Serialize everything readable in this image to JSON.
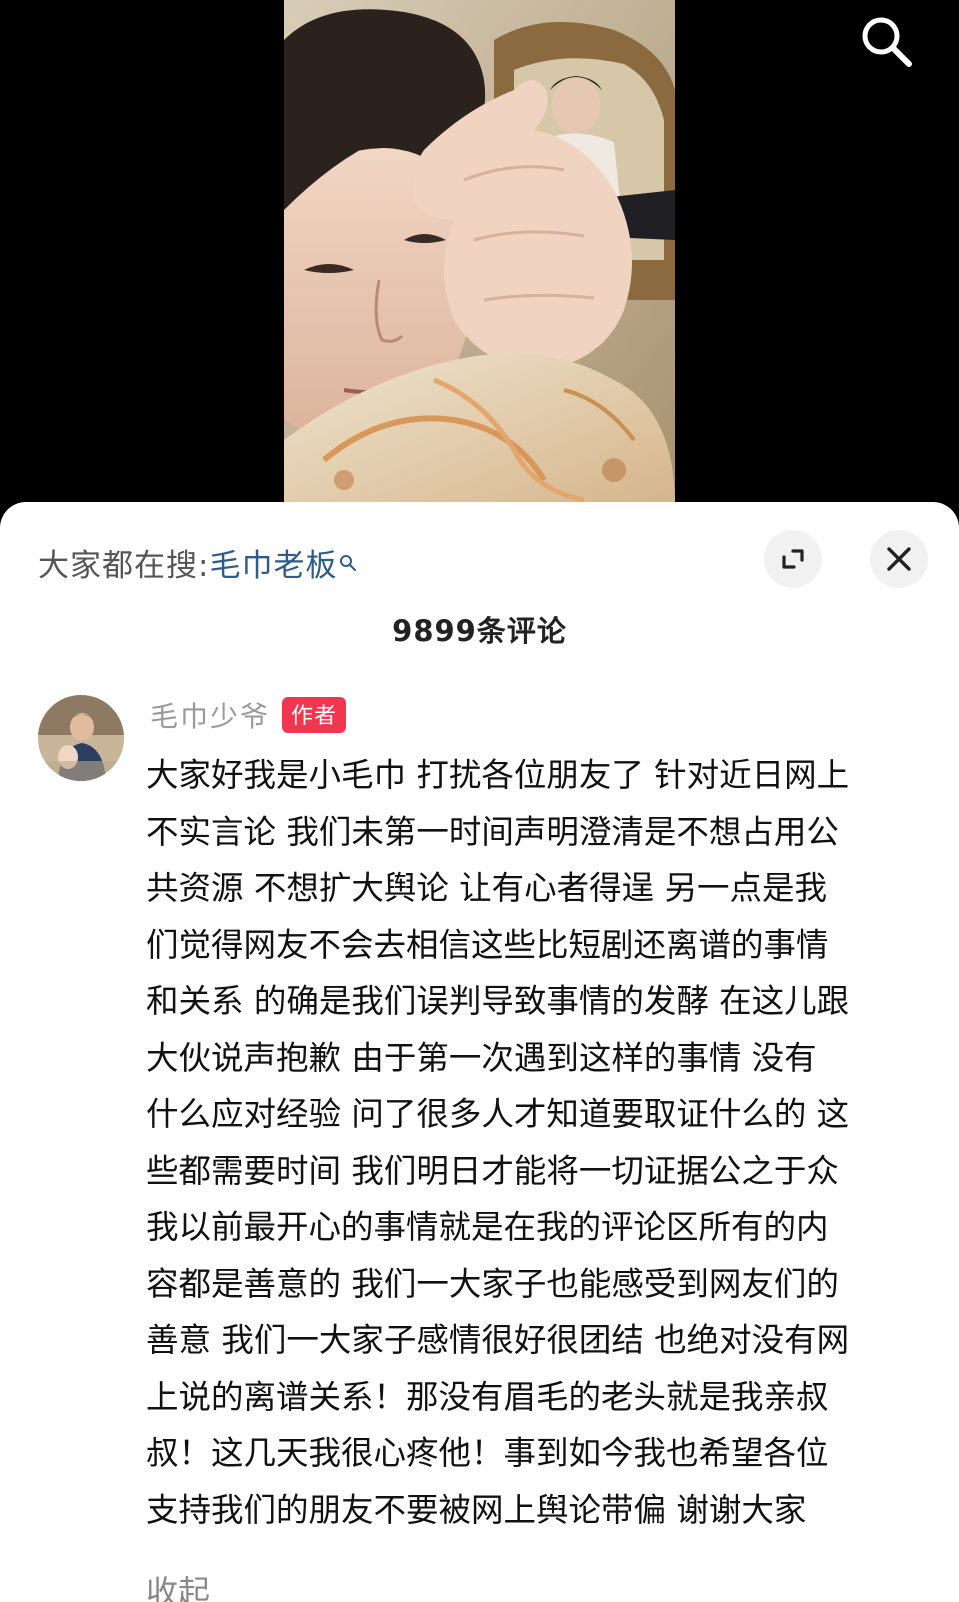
{
  "search_hint": {
    "prefix": "大家都在搜:",
    "term": "毛巾老板"
  },
  "comment_count": "9899条评论",
  "comment": {
    "author": "毛巾少爷",
    "badge": "作者",
    "lines": [
      "大家好我是小毛巾 打扰各位朋友了 针对近日网上",
      "不实言论 我们未第一时间声明澄清是不想占用公",
      "共资源 不想扩大舆论 让有心者得逞 另一点是我",
      "们觉得网友不会去相信这些比短剧还离谱的事情",
      "和关系 的确是我们误判导致事情的发酵 在这儿跟",
      "大伙说声抱歉  由于第一次遇到这样的事情 没有",
      "什么应对经验 问了很多人才知道要取证什么的 这",
      "些都需要时间 我们明日才能将一切证据公之于众",
      "我以前最开心的事情就是在我的评论区所有的内",
      "容都是善意的 我们一大家子也能感受到网友们的",
      "善意 我们一大家子感情很好很团结 也绝对没有网",
      "上说的离谱关系！那没有眉毛的老头就是我亲叔",
      "叔！这几天我很心疼他！事到如今我也希望各位",
      "支持我们的朋友不要被网上舆论带偏 谢谢大家"
    ],
    "collapse_label": "收起"
  },
  "icons": {
    "top_search": "search-icon",
    "expand": "expand-icon",
    "close": "close-icon",
    "search_hint": "search-small-icon"
  },
  "colors": {
    "badge": "#f0374f",
    "link": "#2e5c8a"
  }
}
